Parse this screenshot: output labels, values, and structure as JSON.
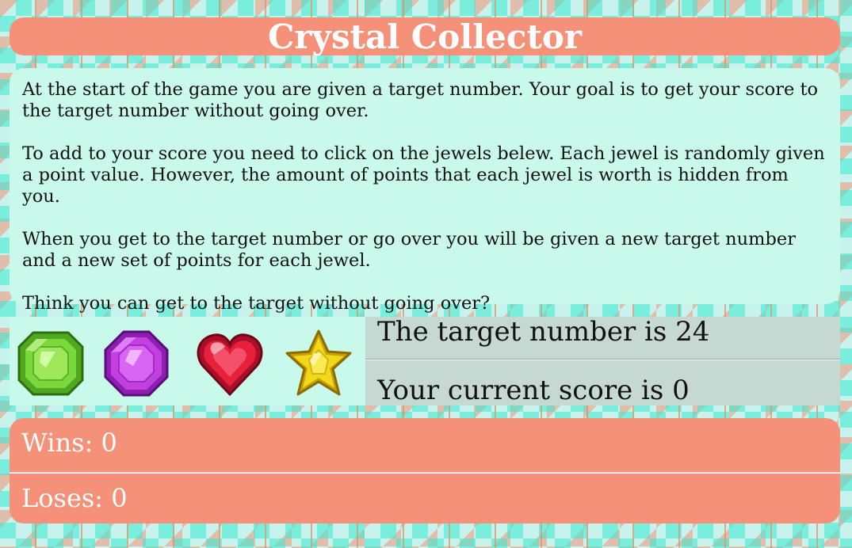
{
  "title": "Crystal Collector",
  "instructions": {
    "paragraphs": [
      "At the start of the game you are given a target number. Your goal is to get your score to the target number without going over.",
      "To add to your score you need to click on the jewels belew. Each jewel is randomly given a point value. However, the amount of points that each jewel is worth is hidden from you.",
      "When you get to the target number or go over you will be given a new target number and a new set of points for each jewel.",
      "Think you can get to the target without going over?"
    ]
  },
  "crystals": [
    {
      "name": "green-gem-icon",
      "color": "#6fd13a"
    },
    {
      "name": "purple-gem-icon",
      "color": "#c23fe0"
    },
    {
      "name": "red-heart-gem-icon",
      "color": "#e8203a"
    },
    {
      "name": "yellow-star-gem-icon",
      "color": "#f2d81a"
    }
  ],
  "game": {
    "target_text": "The target number is 24",
    "score_text": "Your current score is 0"
  },
  "stats": {
    "wins_text": "Wins: 0",
    "loses_text": "Loses: 0"
  },
  "colors": {
    "coral": "#f59079",
    "mint": "#c8f9ea",
    "gray_panel": "#c5d8d1"
  }
}
